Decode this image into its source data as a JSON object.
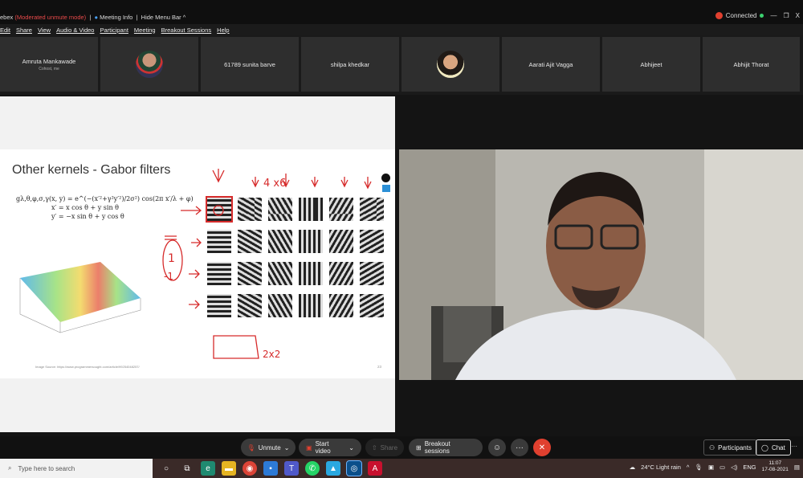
{
  "titlebar": {
    "app": "ebex",
    "mode": "(Moderated unmute mode)",
    "sep": "|",
    "meeting_info": "Meeting Info",
    "hide_menu": "Hide Menu Bar ^",
    "connected": "Connected",
    "minimize": "—",
    "restore": "❐",
    "close": "X"
  },
  "menu": [
    "Edit",
    "Share",
    "View",
    "Audio & Video",
    "Participant",
    "Meeting",
    "Breakout Sessions",
    "Help"
  ],
  "participants": [
    {
      "name": "Amruta Mankawade",
      "sub": "Cohost, me",
      "type": "text"
    },
    {
      "name": "",
      "sub": "",
      "type": "avatar1"
    },
    {
      "name": "61789 sunita barve",
      "sub": "",
      "type": "text"
    },
    {
      "name": "shilpa khedkar",
      "sub": "",
      "type": "text"
    },
    {
      "name": "",
      "sub": "",
      "type": "avatar2"
    },
    {
      "name": "Aarati Ajit Vagga",
      "sub": "",
      "type": "text"
    },
    {
      "name": "Abhijeet",
      "sub": "",
      "type": "text"
    },
    {
      "name": "Abhijit Thorat",
      "sub": "",
      "type": "text"
    }
  ],
  "slide": {
    "title": "Other kernels - Gabor filters",
    "formula_main": "gλ,θ,φ,σ,γ(x, y) = e^(−(x′²+γ²y′²)/2σ²) cos(2π x′/λ + φ)",
    "formula_x": "x′ = x cos θ + y sin θ",
    "formula_y": "y′ = −x sin θ + y cos θ",
    "source": "Image Source: https://www.programmersought.com/article/99254048257/",
    "page": "23",
    "annotations": {
      "a1": "4 x6",
      "a2": "2x2",
      "a3": "1",
      "a4": "-1"
    }
  },
  "controls": {
    "unmute": "Unmute",
    "start_video": "Start video",
    "share": "Share",
    "breakout": "Breakout sessions",
    "participants": "Participants",
    "chat": "Chat",
    "more": "···"
  },
  "taskbar": {
    "search_placeholder": "Type here to search",
    "weather": "24°C  Light rain",
    "lang": "ENG",
    "time": "11:07",
    "date": "17-08-2021"
  },
  "colors": {
    "end_call": "#e0402f",
    "annotation": "#d62b2b",
    "connected": "#3bd16f"
  }
}
